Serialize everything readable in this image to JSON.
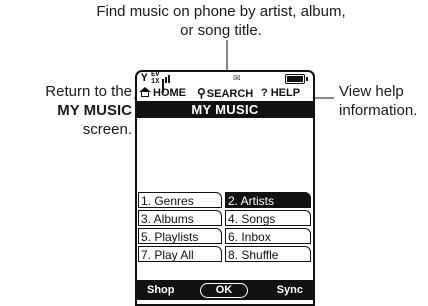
{
  "callouts": {
    "top": "Find music on phone by artist, album, or song title.",
    "left_line1": "Return to the",
    "left_strong": "MY MUSIC",
    "left_line2": "screen.",
    "right": "View help information."
  },
  "status": {
    "signal_icon": "antenna-icon",
    "network_top": "EV",
    "network_bottom": "1X",
    "battery_icon": "battery-full-icon"
  },
  "menubar": {
    "home": "HOME",
    "search": "SEARCH",
    "help": "HELP"
  },
  "screen_title": "MY MUSIC",
  "menu_items": [
    "1. Genres",
    "2. Artists",
    "3. Albums",
    "4. Songs",
    "5. Playlists",
    "6. Inbox",
    "7. Play All",
    "8. Shuffle"
  ],
  "selected_item": "2. Artists",
  "softkeys": {
    "left": "Shop",
    "center": "OK",
    "right": "Sync"
  }
}
